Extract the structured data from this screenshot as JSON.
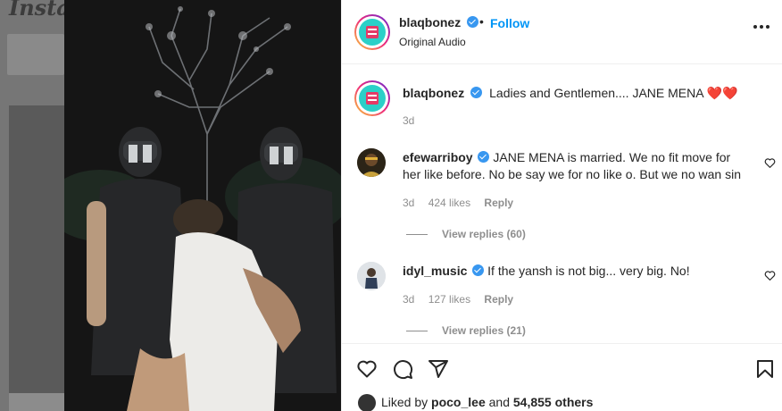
{
  "background": {
    "logo": "Instagram"
  },
  "post": {
    "author": "blaqbonez",
    "follow_label": "Follow",
    "separator": "•",
    "audio": "Original Audio",
    "caption": "Ladies and Gentlemen.... JANE MENA ❤️❤️",
    "caption_time": "3d"
  },
  "comments": [
    {
      "user": "efewarriboy",
      "text": "JANE MENA is married. We no fit move for her like before. No be say we for no like o. But we no wan sin",
      "time": "3d",
      "likes": "424 likes",
      "reply_label": "Reply",
      "view_replies": "View replies (60)"
    },
    {
      "user": "idyl_music",
      "text": "If the yansh is not big... very big. No!",
      "time": "3d",
      "likes": "127 likes",
      "reply_label": "Reply",
      "view_replies": "View replies (21)"
    }
  ],
  "likes": {
    "prefix": "Liked by",
    "user": "poco_lee",
    "conj": "and",
    "others": "54,855 others"
  },
  "icons": {
    "like": "heart-icon",
    "comment": "comment-icon",
    "share": "share-icon",
    "save": "bookmark-icon",
    "more": "more-icon",
    "verified": "verified-badge-icon"
  },
  "colors": {
    "follow": "#0095f6",
    "verified": "#3897f0",
    "muted": "#8e8e8e",
    "text": "#262626"
  }
}
